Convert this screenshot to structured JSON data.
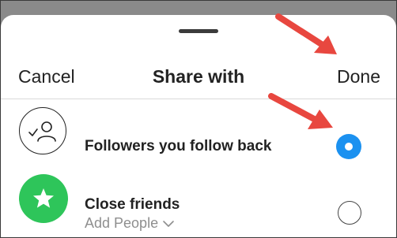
{
  "header": {
    "cancel_label": "Cancel",
    "title": "Share with",
    "done_label": "Done"
  },
  "options": [
    {
      "label": "Followers you follow back",
      "icon": "people-check-icon",
      "selected": true
    },
    {
      "label": "Close friends",
      "sub_label": "Add People",
      "icon": "star-icon",
      "selected": false
    }
  ],
  "colors": {
    "accent": "#1b91f0",
    "close_friends": "#2ec55a",
    "annotation_arrow": "#e8473f"
  }
}
